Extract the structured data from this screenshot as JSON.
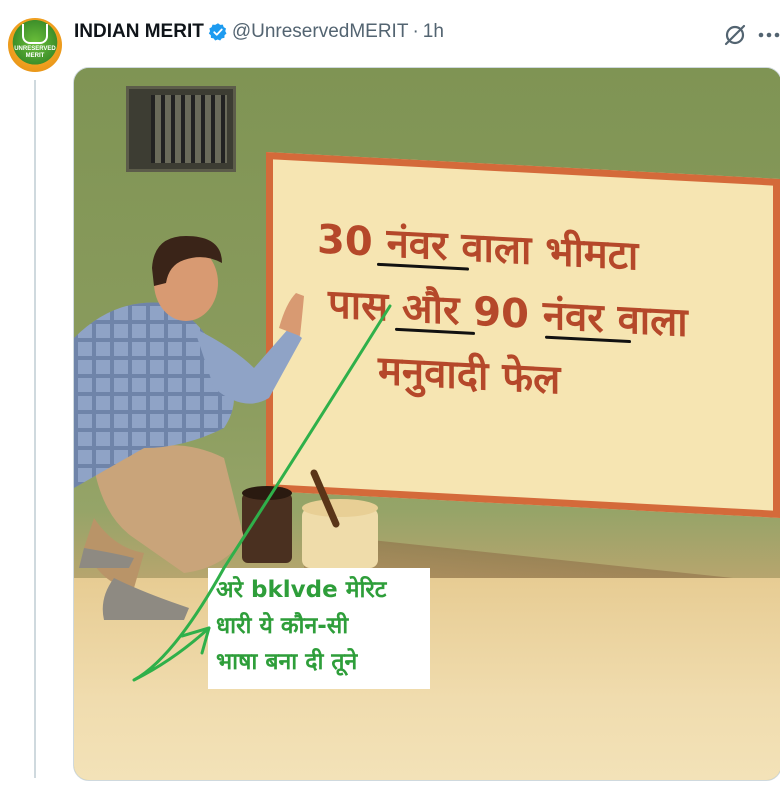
{
  "tweet": {
    "author": {
      "display_name": "INDIAN MERIT",
      "handle": "@UnreservedMERIT",
      "separator": "·",
      "time": "1h",
      "avatar_text": "UNRESERVED MERIT",
      "verified_icon": "verified-badge-icon"
    },
    "actions": {
      "grok_icon": "grok-icon",
      "more_icon": "more-icon"
    },
    "media": {
      "sign_lines": [
        "30 नंवर वाला भीमटा",
        "पास और 90 नंवर वाला",
        "मनुवादी फेल"
      ],
      "caption_lines": [
        "अरे bklvde मेरिट",
        "धारी ये कौन-सी",
        "भाषा बना दी तूने"
      ]
    }
  },
  "colors": {
    "verified": "#1d9bf0",
    "handle": "#536471",
    "sign_text": "#b5482a",
    "sign_border": "#d46a3a",
    "caption_text": "#2e9e3a",
    "annotation_arrow": "#2fb04a"
  }
}
